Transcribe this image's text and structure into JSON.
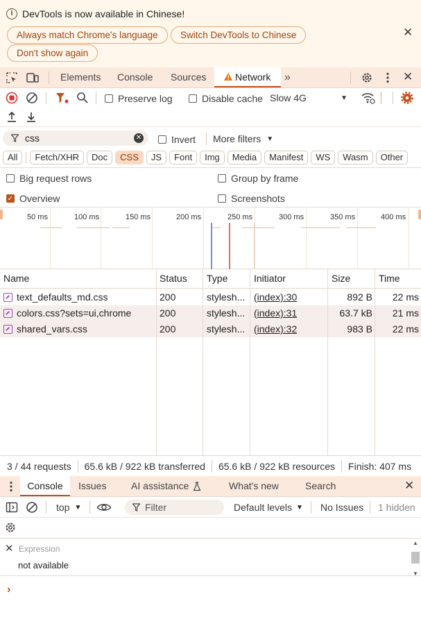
{
  "infobar": {
    "message": "DevTools is now available in Chinese!",
    "buttons": [
      "Always match Chrome's language",
      "Switch DevTools to Chinese",
      "Don't show again"
    ]
  },
  "main_tabs": {
    "items": [
      "Elements",
      "Console",
      "Sources",
      "Network"
    ],
    "active": "Network",
    "more": "»"
  },
  "network_toolbar": {
    "preserve_log": "Preserve log",
    "disable_cache": "Disable cache",
    "throttling": "Slow 4G"
  },
  "filter": {
    "value": "css",
    "invert": "Invert",
    "more_filters": "More filters"
  },
  "types": [
    "All",
    "Fetch/XHR",
    "Doc",
    "CSS",
    "JS",
    "Font",
    "Img",
    "Media",
    "Manifest",
    "WS",
    "Wasm",
    "Other"
  ],
  "selected_type": "CSS",
  "options": {
    "big_request_rows": "Big request rows",
    "group_by_frame": "Group by frame",
    "overview": "Overview",
    "screenshots": "Screenshots"
  },
  "timeline": {
    "ticks": [
      "50 ms",
      "100 ms",
      "150 ms",
      "200 ms",
      "250 ms",
      "300 ms",
      "350 ms",
      "400 ms"
    ]
  },
  "table": {
    "headers": [
      "Name",
      "Status",
      "Type",
      "Initiator",
      "Size",
      "Time"
    ],
    "rows": [
      {
        "name": "text_defaults_md.css",
        "status": "200",
        "type": "stylesh...",
        "initiator": "(index):30",
        "size": "892 B",
        "time": "22 ms"
      },
      {
        "name": "colors.css?sets=ui,chrome",
        "status": "200",
        "type": "stylesh...",
        "initiator": "(index):31",
        "size": "63.7 kB",
        "time": "21 ms"
      },
      {
        "name": "shared_vars.css",
        "status": "200",
        "type": "stylesh...",
        "initiator": "(index):32",
        "size": "983 B",
        "time": "22 ms"
      }
    ]
  },
  "status": {
    "requests": "3 / 44 requests",
    "transferred": "65.6 kB / 922 kB transferred",
    "resources": "65.6 kB / 922 kB resources",
    "finish": "Finish: 407 ms"
  },
  "drawer": {
    "tabs": [
      "Console",
      "Issues",
      "AI assistance",
      "What's new",
      "Search"
    ],
    "active": "Console",
    "context": "top",
    "filter_placeholder": "Filter",
    "levels": "Default levels",
    "issues": "No Issues",
    "hidden": "1 hidden",
    "expression_placeholder": "Expression",
    "expression_value": "not available",
    "prompt": "›"
  },
  "colors": {
    "accent": "#c5511a",
    "tab_bar": "#fbe9dd",
    "infobar": "#fff7ec"
  }
}
